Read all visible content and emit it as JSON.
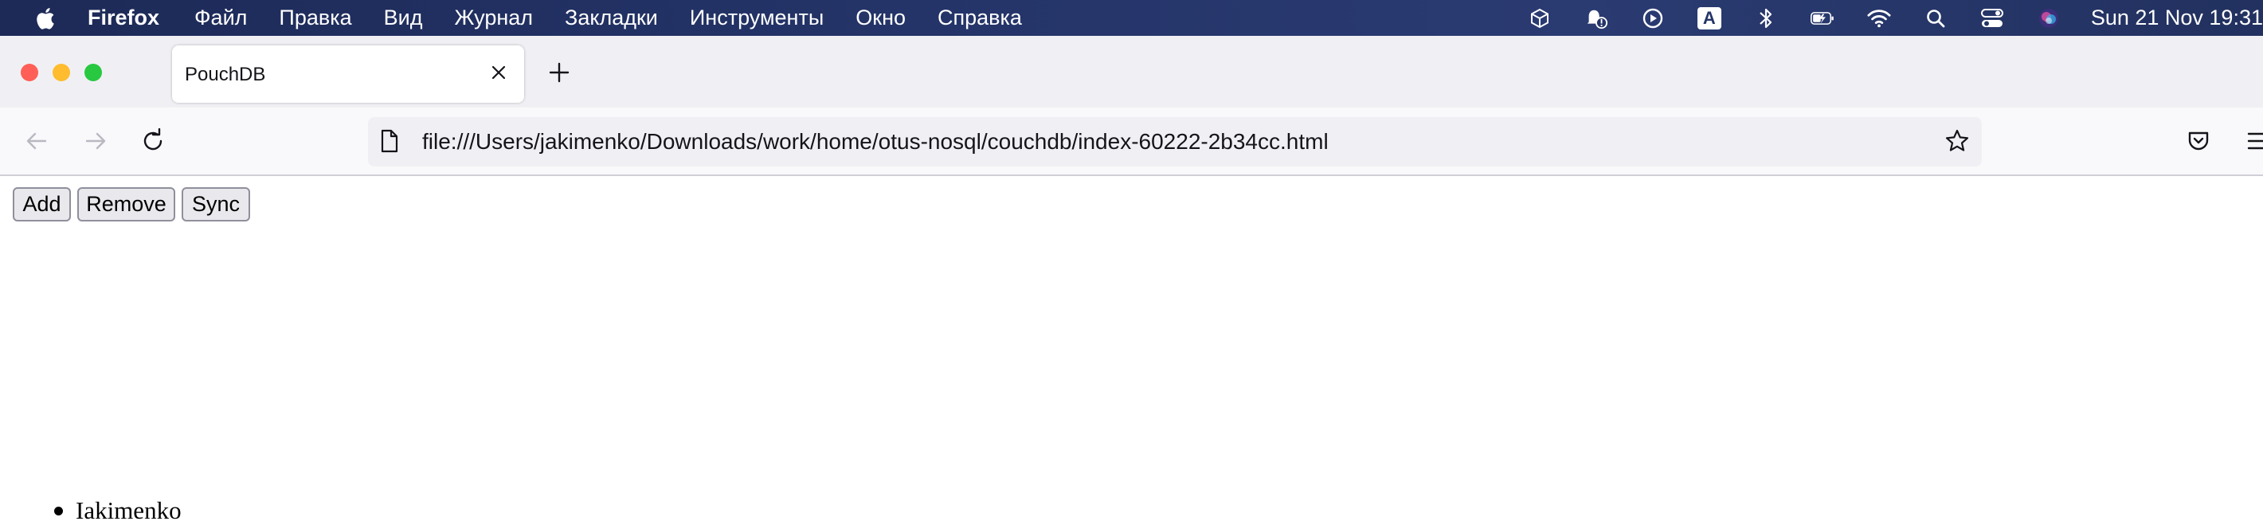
{
  "menubar": {
    "app_name": "Firefox",
    "items": [
      "Файл",
      "Правка",
      "Вид",
      "Журнал",
      "Закладки",
      "Инструменты",
      "Окно",
      "Справка"
    ],
    "status_icons": [
      "dropbox-icon",
      "notification-bell-icon",
      "play-circle-icon",
      "keyboard-input-a-icon",
      "bluetooth-icon",
      "battery-charging-icon",
      "wifi-icon",
      "spotlight-search-icon",
      "control-center-icon",
      "siri-icon"
    ],
    "keyboard_letter": "A",
    "clock": "Sun 21 Nov  19:31"
  },
  "browser": {
    "tab": {
      "title": "PouchDB"
    },
    "url": "file:///Users/jakimenko/Downloads/work/home/otus-nosql/couchdb/index-60222-2b34cc.html"
  },
  "page": {
    "buttons": {
      "add": "Add",
      "remove": "Remove",
      "sync": "Sync"
    },
    "items": [
      "Iakimenko"
    ]
  },
  "colors": {
    "menubar_bg": "#243468",
    "tabstrip_bg": "#f0f0f4",
    "close_red": "#ff5f57",
    "minimize_yellow": "#febc2e",
    "zoom_green": "#28c840"
  }
}
